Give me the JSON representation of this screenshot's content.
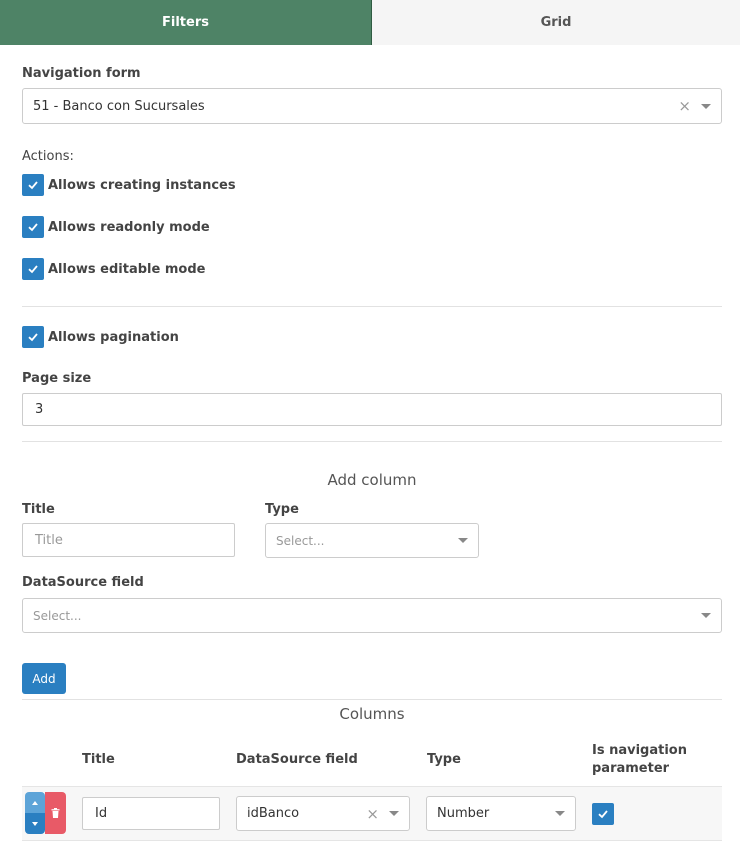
{
  "tabs": [
    {
      "label": "Filters",
      "active": true
    },
    {
      "label": "Grid",
      "active": false
    }
  ],
  "navigation_form": {
    "label": "Navigation form",
    "value": "51 - Banco con Sucursales"
  },
  "actions": {
    "label": "Actions:",
    "items": [
      {
        "label": "Allows creating instances",
        "checked": true
      },
      {
        "label": "Allows readonly mode",
        "checked": true
      },
      {
        "label": "Allows editable mode",
        "checked": true
      }
    ]
  },
  "pagination": {
    "label": "Allows pagination",
    "checked": true
  },
  "page_size": {
    "label": "Page size",
    "value": "3"
  },
  "add_column": {
    "heading": "Add column",
    "title_label": "Title",
    "title_placeholder": "Title",
    "type_label": "Type",
    "type_placeholder": "Select...",
    "datasource_label": "DataSource field",
    "datasource_placeholder": "Select...",
    "add_button": "Add"
  },
  "columns": {
    "heading": "Columns",
    "headers": {
      "title": "Title",
      "datasource": "DataSource field",
      "type": "Type",
      "nav_param_line1": "Is navigation",
      "nav_param_line2": "parameter"
    },
    "rows": [
      {
        "title": "Id",
        "datasource": "idBanco",
        "type": "Number",
        "is_navigation_parameter": true
      }
    ]
  },
  "colors": {
    "active_tab": "#4e8366",
    "primary": "#2a7fc1",
    "danger": "#e85a67"
  }
}
